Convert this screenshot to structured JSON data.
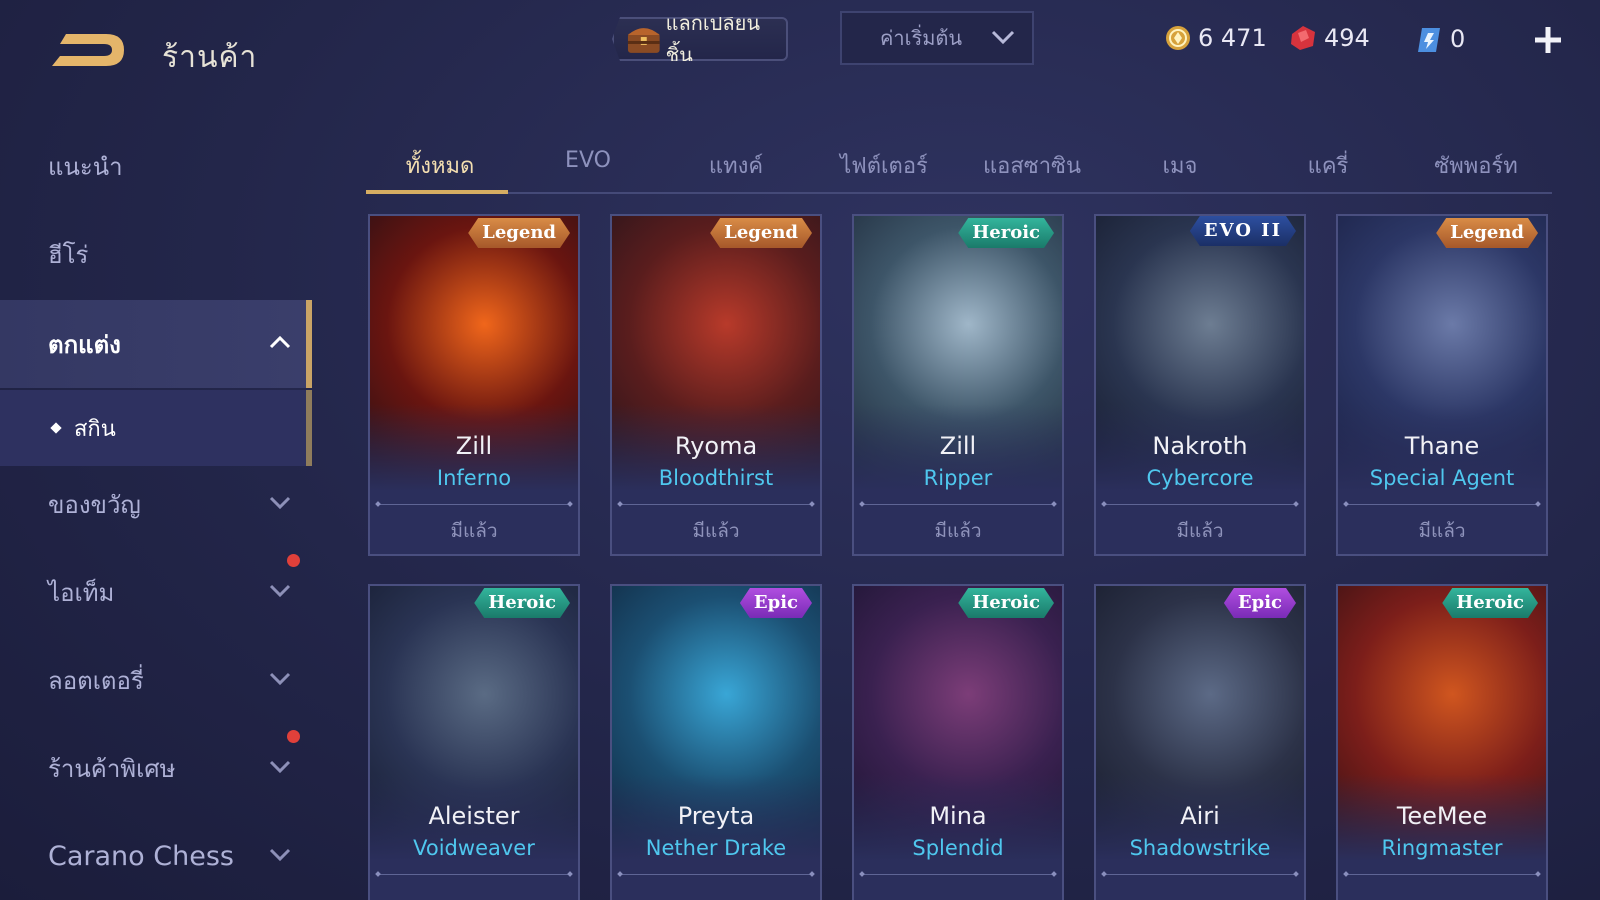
{
  "header": {
    "title": "ร้านค้า",
    "exchange_label": "แลกเปลี่ยนชิ้น",
    "sort_label": "ค่าเริ่มต้น",
    "currencies": [
      {
        "icon": "gold-coin-icon",
        "value": "6 471"
      },
      {
        "icon": "red-voucher-icon",
        "value": "494"
      },
      {
        "icon": "blue-ticket-icon",
        "value": "0"
      }
    ]
  },
  "sidebar": {
    "items": [
      {
        "label": "แนะนำ"
      },
      {
        "label": "ฮีโร่"
      },
      {
        "label": "ตกแต่ง"
      },
      {
        "label": "สกิน"
      },
      {
        "label": "ของขวัญ"
      },
      {
        "label": "ไอเท็ม"
      },
      {
        "label": "ลอตเตอรี่"
      },
      {
        "label": "ร้านค้าพิเศษ"
      },
      {
        "label": "Carano Chess"
      }
    ]
  },
  "tabs": [
    {
      "label": "ทั้งหมด"
    },
    {
      "label": "EVO"
    },
    {
      "label": "แทงค์"
    },
    {
      "label": "ไฟต์เตอร์"
    },
    {
      "label": "แอสซาซิน"
    },
    {
      "label": "เมจ"
    },
    {
      "label": "แครี่"
    },
    {
      "label": "ซัพพอร์ท"
    }
  ],
  "cards": [
    {
      "hero": "Zill",
      "skin": "Inferno",
      "tier": "Legend",
      "status": "มีแล้ว",
      "palette": [
        "#f0661b",
        "#6a1510",
        "#241016"
      ]
    },
    {
      "hero": "Ryoma",
      "skin": "Bloodthirst",
      "tier": "Legend",
      "status": "มีแล้ว",
      "palette": [
        "#b83a2a",
        "#5a1d1d",
        "#24141c"
      ]
    },
    {
      "hero": "Zill",
      "skin": "Ripper",
      "tier": "Heroic",
      "status": "มีแล้ว",
      "palette": [
        "#9fb6c8",
        "#3d5568",
        "#1e2a3b"
      ]
    },
    {
      "hero": "Nakroth",
      "skin": "Cybercore",
      "tier": "EVO II",
      "status": "มีแล้ว",
      "palette": [
        "#6d7d92",
        "#2a3550",
        "#151a2c"
      ]
    },
    {
      "hero": "Thane",
      "skin": "Special Agent",
      "tier": "Legend",
      "status": "มีแล้ว",
      "palette": [
        "#6b7aa8",
        "#2c3766",
        "#1a2044"
      ]
    },
    {
      "hero": "Aleister",
      "skin": "Voidweaver",
      "tier": "Heroic",
      "status": "",
      "palette": [
        "#5a6b84",
        "#2a3454",
        "#161c30"
      ]
    },
    {
      "hero": "Preyta",
      "skin": "Nether Drake",
      "tier": "Epic",
      "status": "",
      "palette": [
        "#39a6d6",
        "#1b4f72",
        "#10253d"
      ]
    },
    {
      "hero": "Mina",
      "skin": "Splendid",
      "tier": "Heroic",
      "status": "",
      "palette": [
        "#7c3d78",
        "#3a2150",
        "#1a1430"
      ]
    },
    {
      "hero": "Airi",
      "skin": "Shadowstrike",
      "tier": "Epic",
      "status": "",
      "palette": [
        "#5c6a86",
        "#2c3248",
        "#161a2a"
      ]
    },
    {
      "hero": "TeeMee",
      "skin": "Ringmaster",
      "tier": "Heroic",
      "status": "",
      "palette": [
        "#d0561f",
        "#7c1e1a",
        "#331014"
      ]
    }
  ],
  "colors": {
    "accent_gold": "#d6ad62",
    "heroic": "#33b59c",
    "epic": "#b04ee0",
    "legend": "#d98c46",
    "skin_name": "#4fc7ee"
  }
}
